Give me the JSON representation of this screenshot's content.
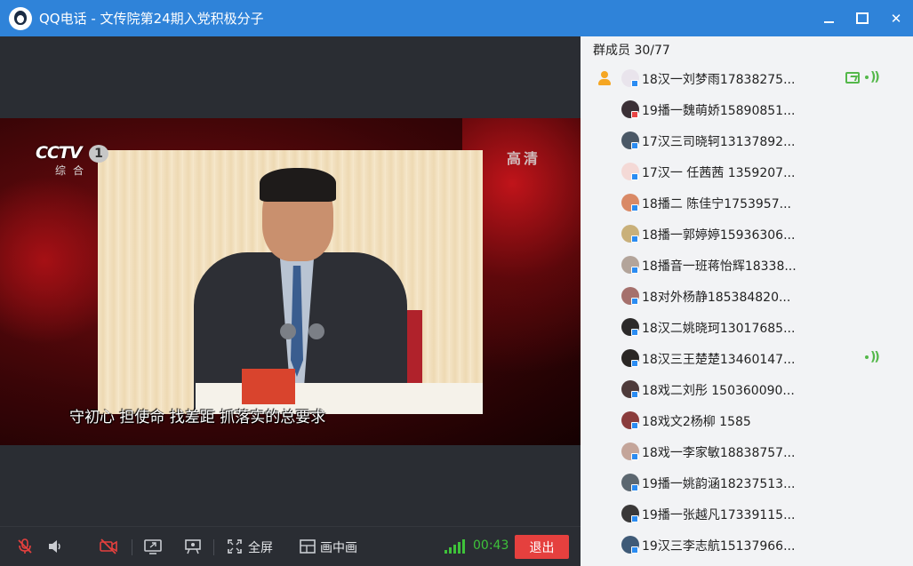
{
  "window": {
    "title": "QQ电话 - 文传院第24期入党积极分子",
    "minimize_icon": "minimize-icon",
    "maximize_icon": "maximize-icon",
    "close_icon": "close-icon",
    "close_glyph": "✕"
  },
  "video": {
    "channel_logo": "CCTV",
    "channel_number": "1",
    "channel_sub": "综合",
    "quality_badge": "高清",
    "subtitle": "守初心 担使命 找差距 抓落实的总要求"
  },
  "toolbar": {
    "fullscreen_label": "全屏",
    "pip_label": "画中画",
    "timer": "00:43",
    "exit_label": "退出",
    "signal_color": "#3ec23a",
    "exit_color": "#e5403e"
  },
  "members": {
    "header": "群成员 30/77",
    "items": [
      {
        "name": "18汉一刘梦雨17838275...",
        "avatar_color": "#e9e4ec",
        "badge": "blue",
        "owner": true,
        "screen_share": true,
        "speaking": true
      },
      {
        "name": "19播一魏萌娇15890851...",
        "avatar_color": "#3b3036",
        "badge": "red",
        "owner": false,
        "screen_share": false,
        "speaking": false
      },
      {
        "name": "17汉三司晓轲13137892...",
        "avatar_color": "#4b5866",
        "badge": "blue",
        "owner": false,
        "screen_share": false,
        "speaking": false
      },
      {
        "name": "17汉一 任茜茜 1359207...",
        "avatar_color": "#f4d9d6",
        "badge": "blue",
        "owner": false,
        "screen_share": false,
        "speaking": false
      },
      {
        "name": "18播二 陈佳宁1753957...",
        "avatar_color": "#d98966",
        "badge": "blue",
        "owner": false,
        "screen_share": false,
        "speaking": false
      },
      {
        "name": "18播一郭婷婷15936306...",
        "avatar_color": "#c9b07a",
        "badge": "blue",
        "owner": false,
        "screen_share": false,
        "speaking": false
      },
      {
        "name": "18播音一班蒋怡辉18338...",
        "avatar_color": "#b3a49a",
        "badge": "blue",
        "owner": false,
        "screen_share": false,
        "speaking": false
      },
      {
        "name": "18对外杨静185384820...",
        "avatar_color": "#a5706c",
        "badge": "blue",
        "owner": false,
        "screen_share": false,
        "speaking": false
      },
      {
        "name": "18汉二姚晓珂13017685...",
        "avatar_color": "#2c2a2a",
        "badge": "blue",
        "owner": false,
        "screen_share": false,
        "speaking": false
      },
      {
        "name": "18汉三王楚楚13460147...",
        "avatar_color": "#2a2624",
        "badge": "blue",
        "owner": false,
        "screen_share": false,
        "speaking": true
      },
      {
        "name": "18戏二刘彤 150360090...",
        "avatar_color": "#4e3a3a",
        "badge": "blue",
        "owner": false,
        "screen_share": false,
        "speaking": false
      },
      {
        "name": "18戏文2杨柳  1585",
        "avatar_color": "#8a3c3c",
        "badge": "blue",
        "owner": false,
        "screen_share": false,
        "speaking": false
      },
      {
        "name": "18戏一李家敏18838757...",
        "avatar_color": "#c4a59a",
        "badge": "blue",
        "owner": false,
        "screen_share": false,
        "speaking": false
      },
      {
        "name": "19播一姚韵涵18237513...",
        "avatar_color": "#5c6770",
        "badge": "blue",
        "owner": false,
        "screen_share": false,
        "speaking": false
      },
      {
        "name": "19播一张越凡17339115...",
        "avatar_color": "#3a3838",
        "badge": "blue",
        "owner": false,
        "screen_share": false,
        "speaking": false
      },
      {
        "name": "19汉三李志航15137966...",
        "avatar_color": "#3f5a77",
        "badge": "blue",
        "owner": false,
        "screen_share": false,
        "speaking": false
      }
    ]
  }
}
